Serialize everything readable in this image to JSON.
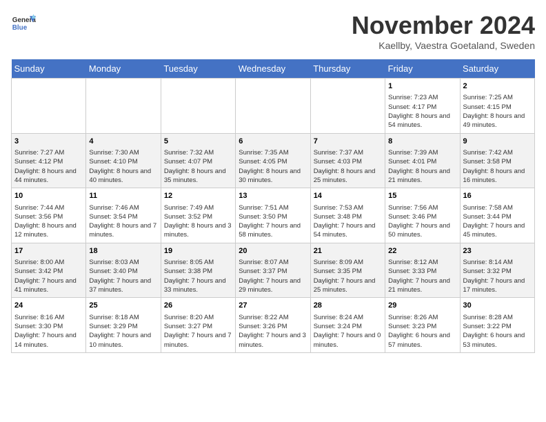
{
  "header": {
    "logo_line1": "General",
    "logo_line2": "Blue",
    "month": "November 2024",
    "location": "Kaellby, Vaestra Goetaland, Sweden"
  },
  "weekdays": [
    "Sunday",
    "Monday",
    "Tuesday",
    "Wednesday",
    "Thursday",
    "Friday",
    "Saturday"
  ],
  "weeks": [
    [
      {
        "day": "",
        "info": ""
      },
      {
        "day": "",
        "info": ""
      },
      {
        "day": "",
        "info": ""
      },
      {
        "day": "",
        "info": ""
      },
      {
        "day": "",
        "info": ""
      },
      {
        "day": "1",
        "info": "Sunrise: 7:23 AM\nSunset: 4:17 PM\nDaylight: 8 hours and 54 minutes."
      },
      {
        "day": "2",
        "info": "Sunrise: 7:25 AM\nSunset: 4:15 PM\nDaylight: 8 hours and 49 minutes."
      }
    ],
    [
      {
        "day": "3",
        "info": "Sunrise: 7:27 AM\nSunset: 4:12 PM\nDaylight: 8 hours and 44 minutes."
      },
      {
        "day": "4",
        "info": "Sunrise: 7:30 AM\nSunset: 4:10 PM\nDaylight: 8 hours and 40 minutes."
      },
      {
        "day": "5",
        "info": "Sunrise: 7:32 AM\nSunset: 4:07 PM\nDaylight: 8 hours and 35 minutes."
      },
      {
        "day": "6",
        "info": "Sunrise: 7:35 AM\nSunset: 4:05 PM\nDaylight: 8 hours and 30 minutes."
      },
      {
        "day": "7",
        "info": "Sunrise: 7:37 AM\nSunset: 4:03 PM\nDaylight: 8 hours and 25 minutes."
      },
      {
        "day": "8",
        "info": "Sunrise: 7:39 AM\nSunset: 4:01 PM\nDaylight: 8 hours and 21 minutes."
      },
      {
        "day": "9",
        "info": "Sunrise: 7:42 AM\nSunset: 3:58 PM\nDaylight: 8 hours and 16 minutes."
      }
    ],
    [
      {
        "day": "10",
        "info": "Sunrise: 7:44 AM\nSunset: 3:56 PM\nDaylight: 8 hours and 12 minutes."
      },
      {
        "day": "11",
        "info": "Sunrise: 7:46 AM\nSunset: 3:54 PM\nDaylight: 8 hours and 7 minutes."
      },
      {
        "day": "12",
        "info": "Sunrise: 7:49 AM\nSunset: 3:52 PM\nDaylight: 8 hours and 3 minutes."
      },
      {
        "day": "13",
        "info": "Sunrise: 7:51 AM\nSunset: 3:50 PM\nDaylight: 7 hours and 58 minutes."
      },
      {
        "day": "14",
        "info": "Sunrise: 7:53 AM\nSunset: 3:48 PM\nDaylight: 7 hours and 54 minutes."
      },
      {
        "day": "15",
        "info": "Sunrise: 7:56 AM\nSunset: 3:46 PM\nDaylight: 7 hours and 50 minutes."
      },
      {
        "day": "16",
        "info": "Sunrise: 7:58 AM\nSunset: 3:44 PM\nDaylight: 7 hours and 45 minutes."
      }
    ],
    [
      {
        "day": "17",
        "info": "Sunrise: 8:00 AM\nSunset: 3:42 PM\nDaylight: 7 hours and 41 minutes."
      },
      {
        "day": "18",
        "info": "Sunrise: 8:03 AM\nSunset: 3:40 PM\nDaylight: 7 hours and 37 minutes."
      },
      {
        "day": "19",
        "info": "Sunrise: 8:05 AM\nSunset: 3:38 PM\nDaylight: 7 hours and 33 minutes."
      },
      {
        "day": "20",
        "info": "Sunrise: 8:07 AM\nSunset: 3:37 PM\nDaylight: 7 hours and 29 minutes."
      },
      {
        "day": "21",
        "info": "Sunrise: 8:09 AM\nSunset: 3:35 PM\nDaylight: 7 hours and 25 minutes."
      },
      {
        "day": "22",
        "info": "Sunrise: 8:12 AM\nSunset: 3:33 PM\nDaylight: 7 hours and 21 minutes."
      },
      {
        "day": "23",
        "info": "Sunrise: 8:14 AM\nSunset: 3:32 PM\nDaylight: 7 hours and 17 minutes."
      }
    ],
    [
      {
        "day": "24",
        "info": "Sunrise: 8:16 AM\nSunset: 3:30 PM\nDaylight: 7 hours and 14 minutes."
      },
      {
        "day": "25",
        "info": "Sunrise: 8:18 AM\nSunset: 3:29 PM\nDaylight: 7 hours and 10 minutes."
      },
      {
        "day": "26",
        "info": "Sunrise: 8:20 AM\nSunset: 3:27 PM\nDaylight: 7 hours and 7 minutes."
      },
      {
        "day": "27",
        "info": "Sunrise: 8:22 AM\nSunset: 3:26 PM\nDaylight: 7 hours and 3 minutes."
      },
      {
        "day": "28",
        "info": "Sunrise: 8:24 AM\nSunset: 3:24 PM\nDaylight: 7 hours and 0 minutes."
      },
      {
        "day": "29",
        "info": "Sunrise: 8:26 AM\nSunset: 3:23 PM\nDaylight: 6 hours and 57 minutes."
      },
      {
        "day": "30",
        "info": "Sunrise: 8:28 AM\nSunset: 3:22 PM\nDaylight: 6 hours and 53 minutes."
      }
    ]
  ]
}
